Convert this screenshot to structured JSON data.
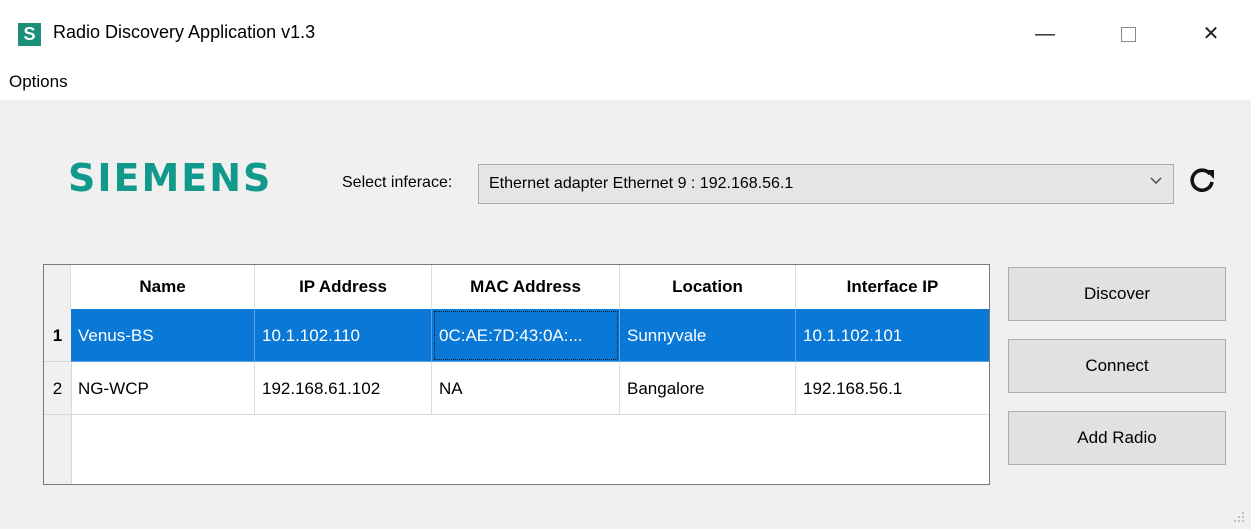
{
  "window": {
    "icon_letter": "S",
    "title": "Radio Discovery Application v1.3",
    "controls": {
      "minimize": "—",
      "close": "✕"
    }
  },
  "menu": {
    "options": "Options"
  },
  "logo": {
    "text": "SIEMENS",
    "color": "#119a8c"
  },
  "interface": {
    "label": "Select inferace:",
    "selected": "Ethernet adapter Ethernet 9 : 192.168.56.1",
    "dropdown_icon": "chevron-down-icon",
    "refresh_icon": "refresh-icon"
  },
  "table": {
    "columns": [
      "Name",
      "IP Address",
      "MAC Address",
      "Location",
      "Interface IP"
    ],
    "rows": [
      {
        "num": "1",
        "name": "Venus-BS",
        "ip": "10.1.102.110",
        "mac": "0C:AE:7D:43:0A:...",
        "location": "Sunnyvale",
        "iface_ip": "10.1.102.101",
        "selected": true
      },
      {
        "num": "2",
        "name": "NG-WCP",
        "ip": "192.168.61.102",
        "mac": "NA",
        "location": "Bangalore",
        "iface_ip": "192.168.56.1",
        "selected": false
      }
    ],
    "selection_color": "#0a78d7"
  },
  "buttons": {
    "discover": "Discover",
    "connect": "Connect",
    "add_radio": "Add Radio"
  }
}
